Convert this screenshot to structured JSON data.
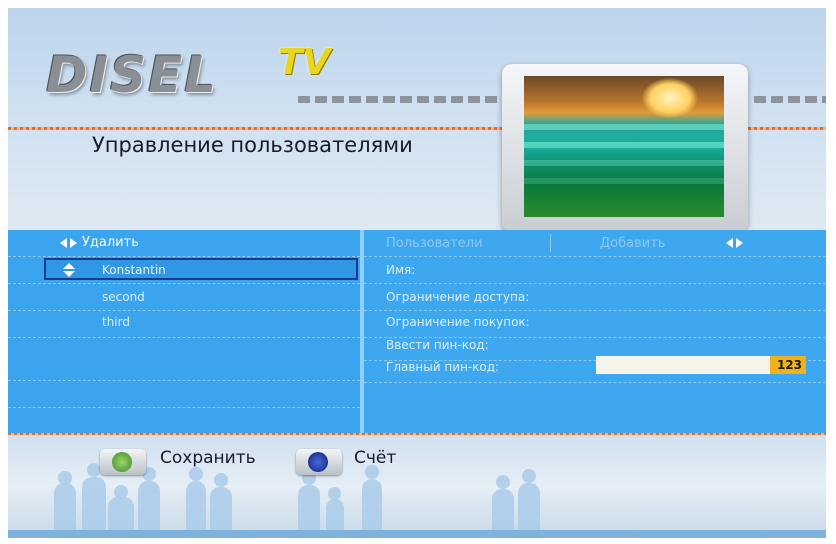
{
  "brand": {
    "logo_main": "DISEL",
    "logo_tv": "TV"
  },
  "page_title": "Управление пользователями",
  "left_panel": {
    "action_label": "Удалить",
    "users": [
      {
        "name": "Konstantin",
        "selected": true
      },
      {
        "name": "second",
        "selected": false
      },
      {
        "name": "third",
        "selected": false
      }
    ]
  },
  "right_panel": {
    "tabs": [
      "Пользователи",
      "Добавить"
    ],
    "fields": [
      {
        "label": "Имя:"
      },
      {
        "label": "Ограничение доступа:"
      },
      {
        "label": "Ограничение покупок:"
      },
      {
        "label": "Ввести пин-код:"
      },
      {
        "label": "Главный пин-код:",
        "value": "123"
      }
    ]
  },
  "footer": {
    "save_label": "Сохранить",
    "account_label": "Счёт",
    "save_icon": "green-circle-icon",
    "account_icon": "blue-circle-icon"
  },
  "colors": {
    "panel": "#3aa4ee",
    "accent": "#f06a20",
    "pin_highlight": "#f0b21c"
  }
}
